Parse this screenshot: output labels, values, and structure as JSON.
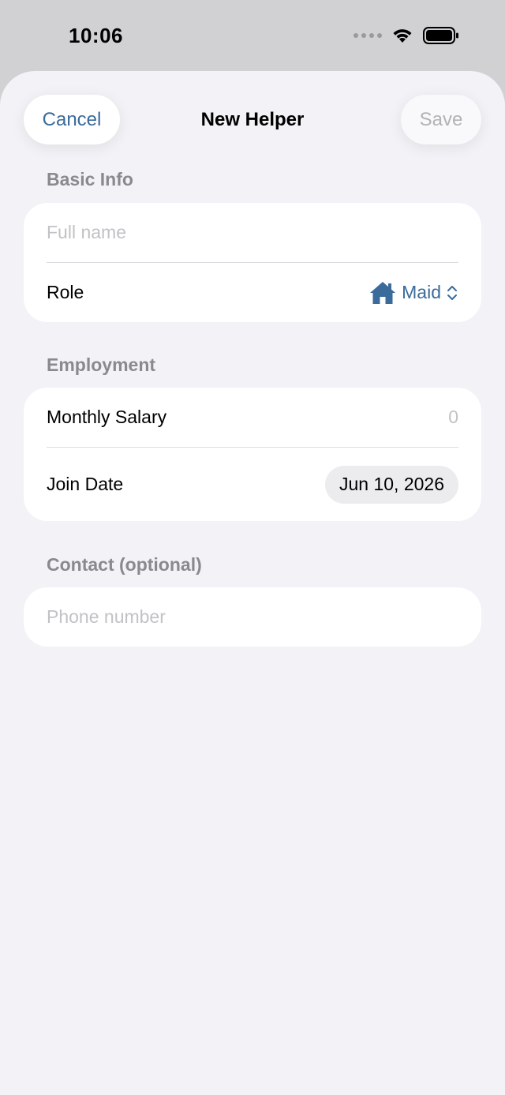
{
  "status_bar": {
    "time": "10:06"
  },
  "nav": {
    "cancel_label": "Cancel",
    "title": "New Helper",
    "save_label": "Save"
  },
  "sections": {
    "basic_info": {
      "header": "Basic Info",
      "name_placeholder": "Full name",
      "role_label": "Role",
      "role_value": "Maid",
      "role_icon": "house-icon"
    },
    "employment": {
      "header": "Employment",
      "salary_label": "Monthly Salary",
      "salary_placeholder": "0",
      "join_date_label": "Join Date",
      "join_date_value": "Jun 10, 2026"
    },
    "contact": {
      "header": "Contact (optional)",
      "phone_placeholder": "Phone number"
    }
  },
  "colors": {
    "accent": "#3a6b9a",
    "background": "#f2f2f7",
    "placeholder": "#c2c2c6",
    "section_header": "#8a8a8e"
  }
}
